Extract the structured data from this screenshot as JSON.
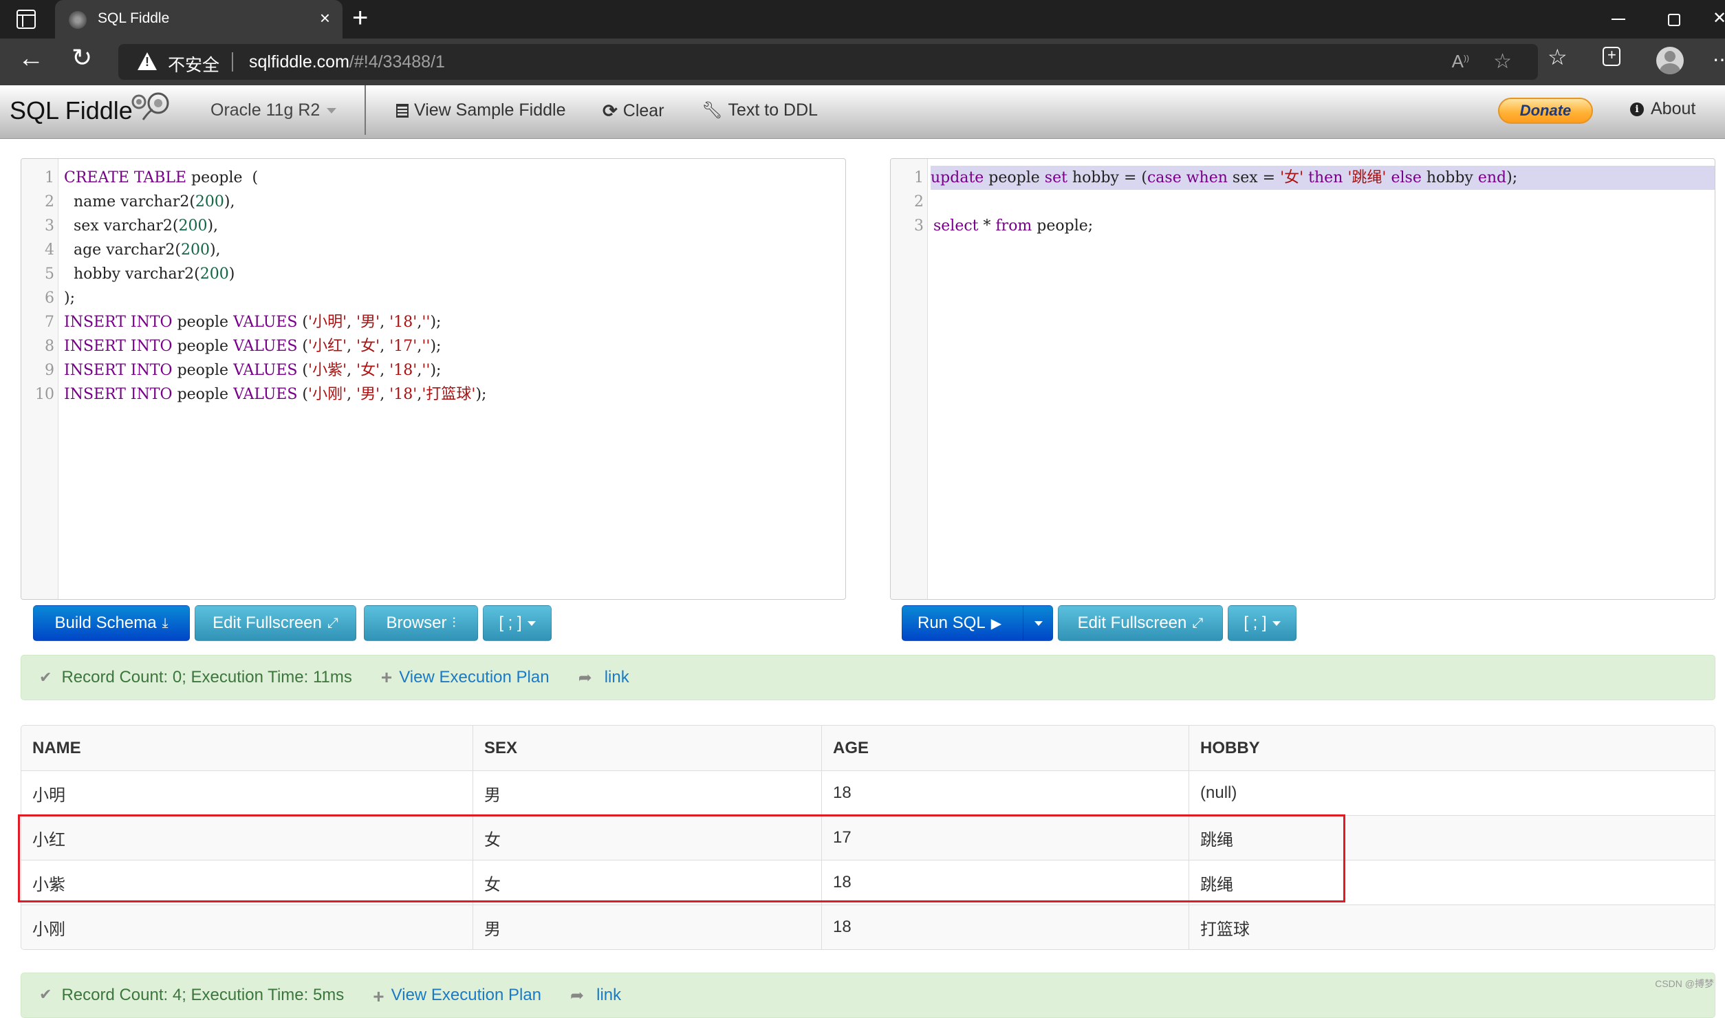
{
  "browser": {
    "tab_title": "SQL Fiddle",
    "tab_close": "×",
    "new_tab": "+",
    "insecure_label": "不安全",
    "url_host": "sqlfiddle.com",
    "url_path": "/#!4/33488/1",
    "icons": [
      "tab-actions-icon",
      "back-icon",
      "reload-icon",
      "warning-icon",
      "read-aloud-icon",
      "add-favorite-icon",
      "favorites-icon",
      "collections-icon",
      "profile-avatar",
      "more-icon",
      "minimize-icon",
      "maximize-icon",
      "close-icon"
    ]
  },
  "navbar": {
    "brand": "SQL Fiddle",
    "db_select": "Oracle 11g R2",
    "view_sample": "View Sample Fiddle",
    "clear": "Clear",
    "text_to_ddl": "Text to DDL",
    "donate": "Donate",
    "about": "About"
  },
  "schema_editor": {
    "lines": [
      [
        {
          "t": "CREATE TABLE",
          "c": "kw"
        },
        {
          "t": " people  (",
          "c": ""
        }
      ],
      [
        {
          "t": "  name varchar2(",
          "c": ""
        },
        {
          "t": "200",
          "c": "num"
        },
        {
          "t": "),",
          "c": ""
        }
      ],
      [
        {
          "t": "  sex varchar2(",
          "c": ""
        },
        {
          "t": "200",
          "c": "num"
        },
        {
          "t": "),",
          "c": ""
        }
      ],
      [
        {
          "t": "  age varchar2(",
          "c": ""
        },
        {
          "t": "200",
          "c": "num"
        },
        {
          "t": "),",
          "c": ""
        }
      ],
      [
        {
          "t": "  hobby varchar2(",
          "c": ""
        },
        {
          "t": "200",
          "c": "num"
        },
        {
          "t": ")",
          "c": ""
        }
      ],
      [
        {
          "t": ");",
          "c": ""
        }
      ],
      [
        {
          "t": "INSERT INTO",
          "c": "kw"
        },
        {
          "t": " people ",
          "c": ""
        },
        {
          "t": "VALUES",
          "c": "kw"
        },
        {
          "t": " (",
          "c": ""
        },
        {
          "t": "'小明'",
          "c": "str"
        },
        {
          "t": ", ",
          "c": ""
        },
        {
          "t": "'男'",
          "c": "str"
        },
        {
          "t": ", ",
          "c": ""
        },
        {
          "t": "'18'",
          "c": "str"
        },
        {
          "t": ",",
          "c": ""
        },
        {
          "t": "''",
          "c": "str"
        },
        {
          "t": ");",
          "c": ""
        }
      ],
      [
        {
          "t": "INSERT INTO",
          "c": "kw"
        },
        {
          "t": " people ",
          "c": ""
        },
        {
          "t": "VALUES",
          "c": "kw"
        },
        {
          "t": " (",
          "c": ""
        },
        {
          "t": "'小红'",
          "c": "str"
        },
        {
          "t": ", ",
          "c": ""
        },
        {
          "t": "'女'",
          "c": "str"
        },
        {
          "t": ", ",
          "c": ""
        },
        {
          "t": "'17'",
          "c": "str"
        },
        {
          "t": ",",
          "c": ""
        },
        {
          "t": "''",
          "c": "str"
        },
        {
          "t": ");",
          "c": ""
        }
      ],
      [
        {
          "t": "INSERT INTO",
          "c": "kw"
        },
        {
          "t": " people ",
          "c": ""
        },
        {
          "t": "VALUES",
          "c": "kw"
        },
        {
          "t": " (",
          "c": ""
        },
        {
          "t": "'小紫'",
          "c": "str"
        },
        {
          "t": ", ",
          "c": ""
        },
        {
          "t": "'女'",
          "c": "str"
        },
        {
          "t": ", ",
          "c": ""
        },
        {
          "t": "'18'",
          "c": "str"
        },
        {
          "t": ",",
          "c": ""
        },
        {
          "t": "''",
          "c": "str"
        },
        {
          "t": ");",
          "c": ""
        }
      ],
      [
        {
          "t": "INSERT INTO",
          "c": "kw"
        },
        {
          "t": " people ",
          "c": ""
        },
        {
          "t": "VALUES",
          "c": "kw"
        },
        {
          "t": " (",
          "c": ""
        },
        {
          "t": "'小刚'",
          "c": "str"
        },
        {
          "t": ", ",
          "c": ""
        },
        {
          "t": "'男'",
          "c": "str"
        },
        {
          "t": ", ",
          "c": ""
        },
        {
          "t": "'18'",
          "c": "str"
        },
        {
          "t": ",",
          "c": ""
        },
        {
          "t": "'打篮球'",
          "c": "str"
        },
        {
          "t": ");",
          "c": ""
        }
      ]
    ],
    "buttons": {
      "build_schema": "Build Schema",
      "edit_fullscreen": "Edit Fullscreen",
      "browser": "Browser",
      "delimiter": "[ ; ]"
    }
  },
  "query_editor": {
    "active_line": 1,
    "lines": [
      [
        {
          "t": "update",
          "c": "kw"
        },
        {
          "t": " people ",
          "c": ""
        },
        {
          "t": "set",
          "c": "kw"
        },
        {
          "t": " hobby = (",
          "c": ""
        },
        {
          "t": "case",
          "c": "kw"
        },
        {
          "t": " ",
          "c": ""
        },
        {
          "t": "when",
          "c": "kw"
        },
        {
          "t": " sex = ",
          "c": ""
        },
        {
          "t": "'女'",
          "c": "str"
        },
        {
          "t": " ",
          "c": ""
        },
        {
          "t": "then",
          "c": "kw"
        },
        {
          "t": " ",
          "c": ""
        },
        {
          "t": "'跳绳'",
          "c": "str"
        },
        {
          "t": " ",
          "c": ""
        },
        {
          "t": "else",
          "c": "kw"
        },
        {
          "t": " hobby ",
          "c": ""
        },
        {
          "t": "end",
          "c": "kw"
        },
        {
          "t": ");",
          "c": ""
        }
      ],
      [],
      [
        {
          "t": "select",
          "c": "kw"
        },
        {
          "t": " * ",
          "c": ""
        },
        {
          "t": "from",
          "c": "kw"
        },
        {
          "t": " people;",
          "c": ""
        }
      ]
    ],
    "buttons": {
      "run_sql": "Run SQL",
      "edit_fullscreen": "Edit Fullscreen",
      "delimiter": "[ ; ]"
    }
  },
  "schema_status": {
    "status": "Record Count: 0; Execution Time: 11ms",
    "view_plan": "View Execution Plan",
    "link": "link"
  },
  "results": {
    "columns": [
      "NAME",
      "SEX",
      "AGE",
      "HOBBY"
    ],
    "rows": [
      [
        "小明",
        "男",
        "18",
        "(null)"
      ],
      [
        "小红",
        "女",
        "17",
        "跳绳"
      ],
      [
        "小紫",
        "女",
        "18",
        "跳绳"
      ],
      [
        "小刚",
        "男",
        "18",
        "打篮球"
      ]
    ],
    "highlighted_rows": [
      1,
      2
    ]
  },
  "query_status": {
    "status": "Record Count: 4; Execution Time: 5ms",
    "view_plan": "View Execution Plan",
    "link": "link"
  },
  "watermark": "CSDN @搏梦",
  "colors": {
    "primary_button": "#0046c7",
    "info_button": "#3193b6",
    "success_bg": "#dff0d8",
    "highlight_box": "#e01b24",
    "keyword": "#770088",
    "string": "#aa1111"
  }
}
